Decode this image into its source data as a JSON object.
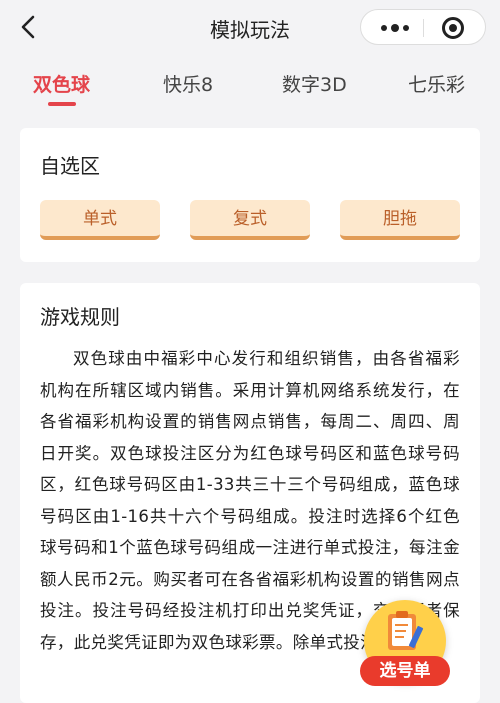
{
  "header": {
    "title": "模拟玩法",
    "back_icon": "chevron-left-icon",
    "more_icon": "more-dots-icon",
    "close_icon": "target-close-icon"
  },
  "tabs": [
    {
      "label": "双色球",
      "active": true
    },
    {
      "label": "快乐8",
      "active": false
    },
    {
      "label": "数字3D",
      "active": false
    },
    {
      "label": "七乐彩",
      "active": false
    }
  ],
  "self_select": {
    "title": "自选区",
    "buttons": [
      "单式",
      "复式",
      "胆拖"
    ]
  },
  "rules": {
    "title": "游戏规则",
    "text": "双色球由中福彩中心发行和组织销售，由各省福彩机构在所辖区域内销售。采用计算机网络系统发行，在各省福彩机构设置的销售网点销售，每周二、周四、周日开奖。双色球投注区分为红色球号码区和蓝色球号码区，红色球号码区由1-33共三十三个号码组成，蓝色球号码区由1-16共十六个号码组成。投注时选择6个红色球号码和1个蓝色球号码组成一注进行单式投注，每注金额人民币2元。购买者可在各省福彩机构设置的销售网点投注。投注号码经投注机打印出兑奖凭证，交购买者保存，此兑奖凭证即为双色球彩票。除单式投注外，"
  },
  "floating": {
    "label": "选号单",
    "icon": "clipboard-pencil-icon"
  },
  "colors": {
    "accent_red": "#e4444b",
    "button_bg": "#fde8cd",
    "button_text": "#ba5f29",
    "fab_yellow": "#ffd04a",
    "fab_red": "#e93b2c"
  }
}
